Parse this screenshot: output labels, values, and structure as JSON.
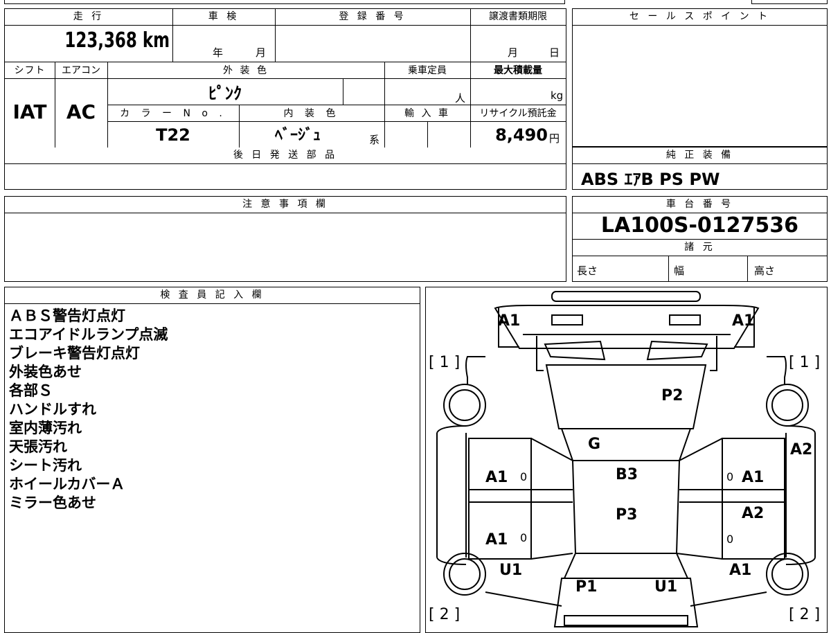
{
  "labels": {
    "mileage": "走 行",
    "inspection": "車 検",
    "registration": "登 録 番 号",
    "transfer_deadline": "譲渡書類期限",
    "sales_point": "セ ー ル ス ポ イ ン ト",
    "shift": "シフト",
    "aircon": "エアコン",
    "exterior_color": "外 装 色",
    "capacity": "乗車定員",
    "max_load": "最大積載量",
    "color_no": "カ ラ ー N o .",
    "interior_color": "内 装 色",
    "import": "輸 入 車",
    "recycle_fee": "リサイクル預託金",
    "later_parts": "後 日 発 送 部 品",
    "genuine_equipment": "純 正 装 備",
    "remarks": "注 意 事 項 欄",
    "chassis": "車 台 番 号",
    "specs": "諸 元",
    "length": "長さ",
    "width": "幅",
    "height": "高さ",
    "inspector": "検 査 員 記 入 欄"
  },
  "values": {
    "mileage": "123,368 km",
    "insp_year_unit": "年",
    "insp_month_unit": "月",
    "transfer_month_unit": "月",
    "transfer_day_unit": "日",
    "shift": "IAT",
    "aircon": "AC",
    "exterior_color": "ﾋﾟﾝｸ",
    "capacity_unit": "人",
    "load_unit": "kg",
    "color_no": "T22",
    "interior_color": "ﾍﾞｰｼﾞｭ",
    "interior_suffix": "系",
    "recycle_fee": "8,490",
    "yen_unit": "円",
    "genuine_equipment": "ABS ｴｱB PS PW",
    "chassis_no": "LA100S-0127536"
  },
  "inspector_notes": [
    "ＡＢＳ警告灯点灯",
    "エコアイドルランプ点滅",
    "ブレーキ警告灯点灯",
    "外装色あせ",
    "各部Ｓ",
    "ハンドルすれ",
    "室内薄汚れ",
    "天張汚れ",
    "シート汚れ",
    "ホイールカバーＡ",
    "ミラー色あせ"
  ],
  "diagram": {
    "corner_1": "[ 1 ]",
    "corner_2": "[ 2 ]",
    "marks": {
      "front_left_a1": "A1",
      "front_right_a1": "A1",
      "hood": "P2",
      "windshield": "G",
      "roof": "B3",
      "roof_rear": "P3",
      "left_front_door": "A1",
      "right_front_door": "A1",
      "right_fender": "A2",
      "right_rear_door": "A2",
      "left_rear_door": "A1",
      "left_rear_u1": "U1",
      "right_rear_a1": "A1",
      "back_p1": "P1",
      "back_u1": "U1",
      "zero": "0"
    }
  }
}
